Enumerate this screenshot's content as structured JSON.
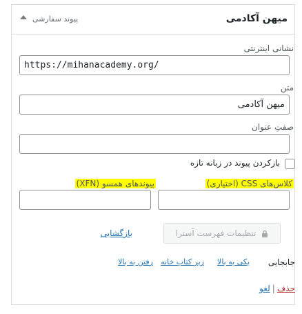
{
  "panel": {
    "title": "میهن آکادمی",
    "item_type": "پیوند سفارشی"
  },
  "fields": {
    "url_label": "نشانی اینترنتی",
    "url_value": "https://mihanacademy.org/",
    "text_label": "متن",
    "text_value": "میهن آکادمی",
    "title_attr_label": "صفتِ عنوان",
    "title_attr_value": "",
    "new_tab_label": "بازکردن پیوند در زبانه تازه",
    "new_tab_checked": false,
    "css_label": "کلاس‌های CSS (اختیاری)",
    "css_value": "",
    "xfn_label": "پیوندهای همسو (XFN)",
    "xfn_value": ""
  },
  "buttons": {
    "astra_settings": "تنظیمات فهرست آسترا",
    "revoke": "بازگشایی"
  },
  "move": {
    "label": "جابجایی",
    "up_one": "یکی به بالا",
    "under": "زیر کتاب خانه",
    "to_top": "رفتن به بالا"
  },
  "actions": {
    "remove": "حذف",
    "cancel": "لغو"
  },
  "colors": {
    "link": "#2271b1",
    "remove": "#b32d2e",
    "highlight": "#ffff00"
  }
}
